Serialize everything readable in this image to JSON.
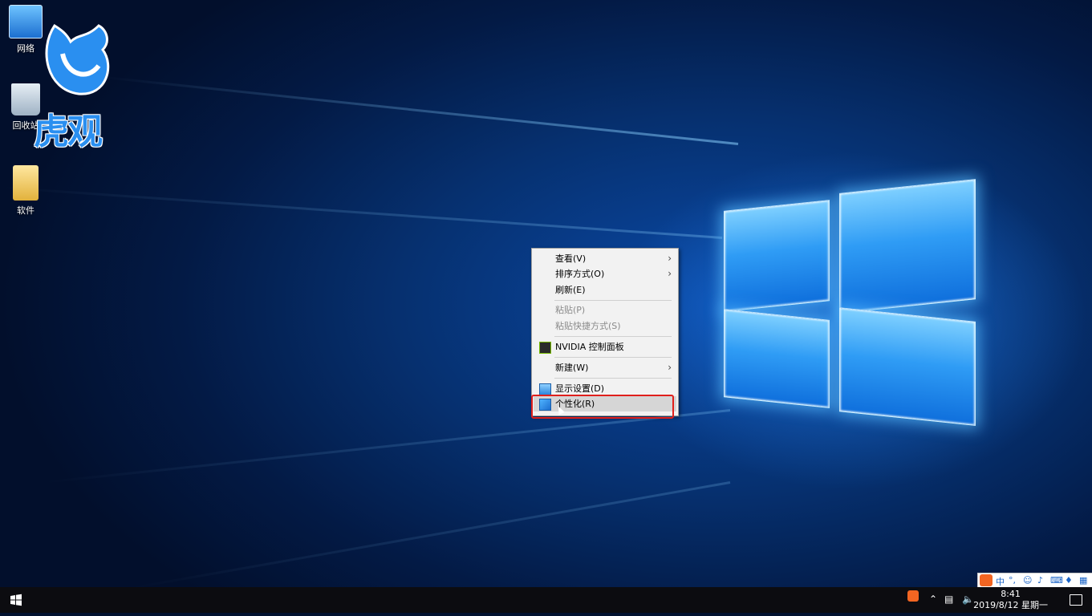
{
  "desktop": {
    "icons": [
      {
        "label": "网络"
      },
      {
        "label": "回收站"
      },
      {
        "label": "软件"
      }
    ],
    "watermark_text": "虎观"
  },
  "context_menu": {
    "items": [
      {
        "label": "查看(V)",
        "submenu": true
      },
      {
        "label": "排序方式(O)",
        "submenu": true
      },
      {
        "label": "刷新(E)"
      },
      {
        "label": "粘贴(P)",
        "disabled": true
      },
      {
        "label": "粘贴快捷方式(S)",
        "disabled": true
      },
      {
        "label": "NVIDIA 控制面板",
        "icon": "nvidia-icon"
      },
      {
        "label": "新建(W)",
        "submenu": true
      },
      {
        "label": "显示设置(D)",
        "icon": "display-icon"
      },
      {
        "label": "个性化(R)",
        "icon": "personalize-icon",
        "highlighted": true
      }
    ]
  },
  "ime": {
    "lang": "中"
  },
  "taskbar": {
    "time": "8:41",
    "date": "2019/8/12 星期一",
    "accent": "#0c0c10"
  }
}
